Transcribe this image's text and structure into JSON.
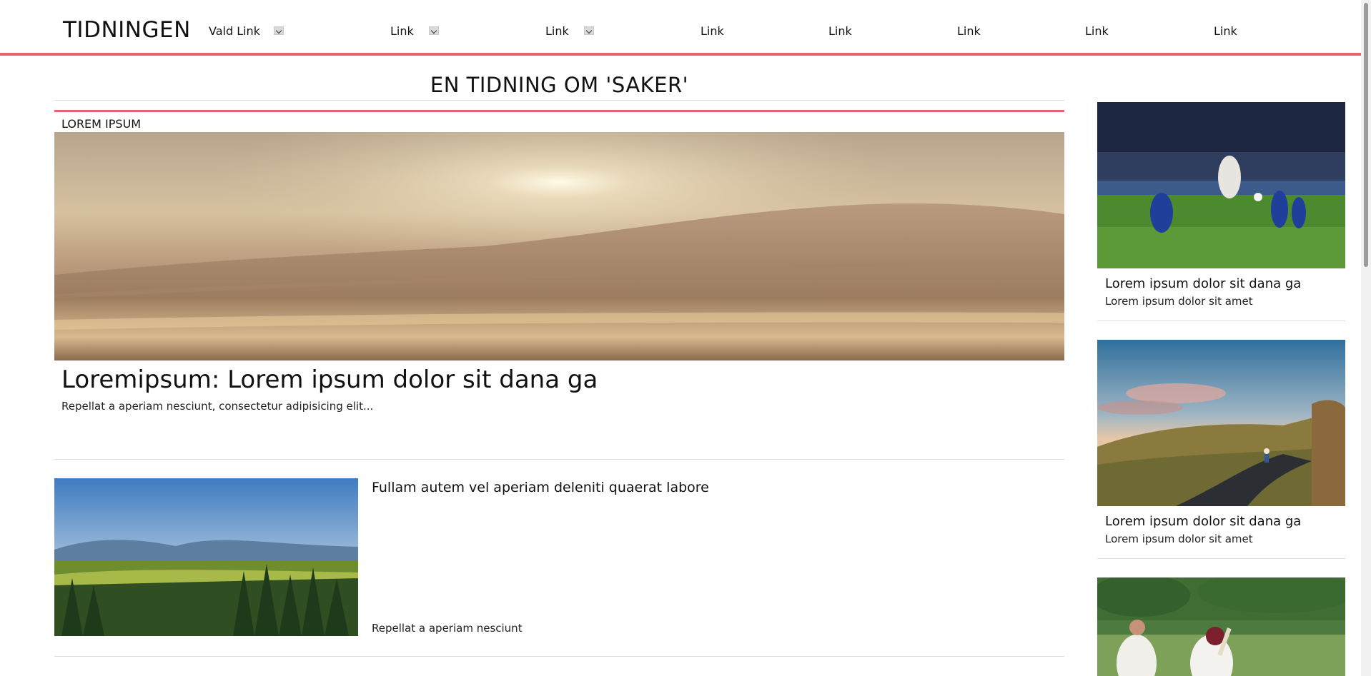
{
  "header": {
    "logo": "TIDNINGEN",
    "nav": [
      {
        "label": "Vald Link",
        "dropdown": true
      },
      {
        "label": "Link",
        "dropdown": true
      },
      {
        "label": "Link",
        "dropdown": true
      },
      {
        "label": "Link",
        "dropdown": false
      },
      {
        "label": "Link",
        "dropdown": false
      },
      {
        "label": "Link",
        "dropdown": false
      },
      {
        "label": "Link",
        "dropdown": false
      },
      {
        "label": "Link",
        "dropdown": false
      }
    ]
  },
  "page_title": "EN TIDNING OM 'SAKER'",
  "featured": {
    "kicker": "LOREM IPSUM",
    "image": "desert-dunes-sunset-photo",
    "headline": "Loremipsum: Lorem ipsum dolor sit dana ga",
    "lede": "Repellat a aperiam nesciunt, consectetur adipisicing elit..."
  },
  "article2": {
    "image": "forest-valley-landscape-photo",
    "title": "Fullam autem vel aperiam deleniti quaerat labore",
    "subtitle": "Repellat a aperiam nesciunt"
  },
  "sidebar": [
    {
      "image": "football-match-photo",
      "title": "Lorem ipsum dolor sit dana ga",
      "subtitle": "Lorem ipsum dolor sit amet"
    },
    {
      "image": "cyclist-mountain-road-photo",
      "title": "Lorem ipsum dolor sit dana ga",
      "subtitle": "Lorem ipsum dolor sit amet"
    },
    {
      "image": "cricket-match-photo"
    }
  ],
  "colors": {
    "accent": "#e7636f",
    "divider": "#d8dbe0"
  }
}
